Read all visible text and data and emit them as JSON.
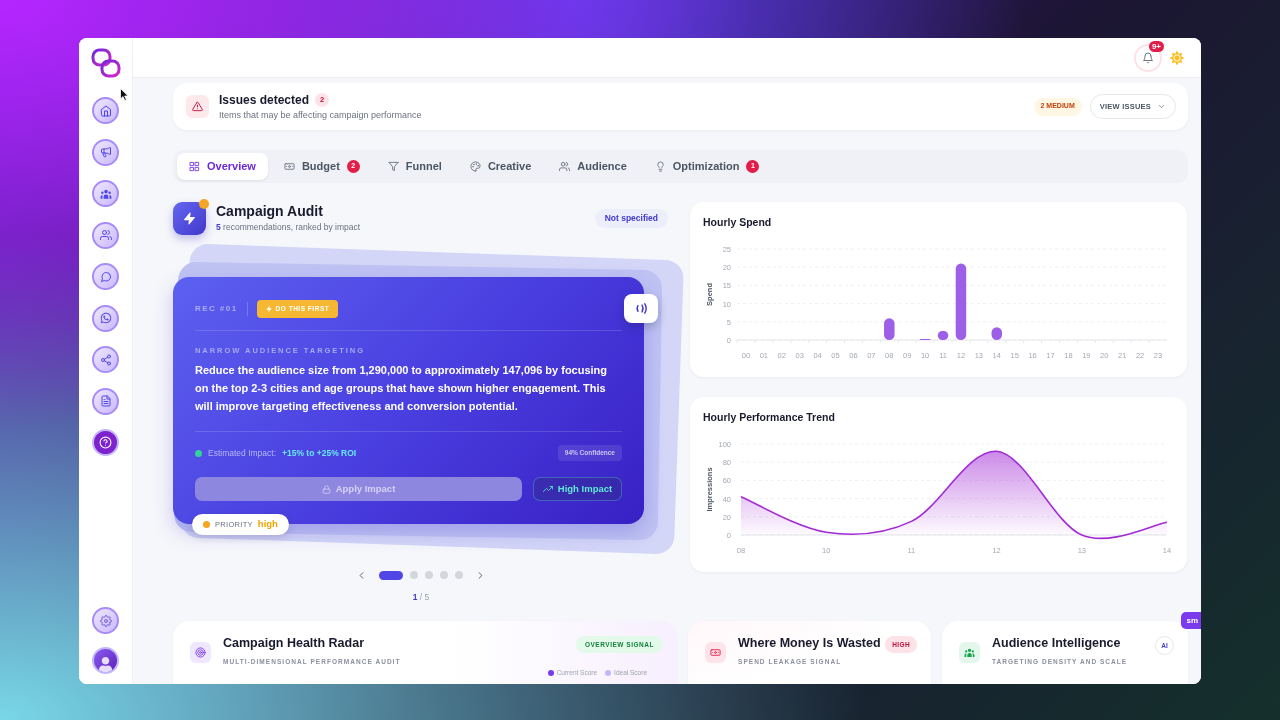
{
  "header": {
    "notification_badge": "9+"
  },
  "issues_banner": {
    "title": "Issues detected",
    "count": "2",
    "subtitle": "Items that may be affecting campaign performance",
    "severity": "2 MEDIUM",
    "action": "VIEW ISSUES"
  },
  "tabs": [
    {
      "label": "Overview",
      "selected": true
    },
    {
      "label": "Budget",
      "badge": "2",
      "selected": false
    },
    {
      "label": "Funnel",
      "selected": false
    },
    {
      "label": "Creative",
      "selected": false
    },
    {
      "label": "Audience",
      "selected": false
    },
    {
      "label": "Optimization",
      "badge": "1",
      "selected": false
    }
  ],
  "campaign_audit": {
    "title": "Campaign Audit",
    "subtitle": "**5** recommendations, ranked by impact",
    "status": "Not specified",
    "recommendation": {
      "rec_label": "REC #01",
      "tag": "DO THIS FIRST",
      "category": "NARROW AUDIENCE TARGETING",
      "description": "Reduce the audience size from 1,290,000 to approximately 147,096 by focusing on the top 2-3 cities and age groups that have shown higher engagement. This will improve targeting effectiveness and conversion potential.",
      "impact_label": "Estimated Impact:",
      "impact_value": "+15% to +25% ROI",
      "confidence": "94% Confidence",
      "apply_button": {
        "label": "Apply Impact",
        "disabled": true
      },
      "impact_button": "High Impact",
      "priority_label": "PRIORITY",
      "priority_value": "high"
    },
    "pagination": {
      "dots": [
        {
          "selected": true
        },
        {
          "selected": false
        },
        {
          "selected": false
        },
        {
          "selected": false
        },
        {
          "selected": false
        }
      ],
      "indicator": "**1** / 5"
    }
  },
  "hourly_spend": {
    "chart_data": {
      "type": "bar",
      "title": "Hourly Spend",
      "ylabel": "Spend",
      "categories": [
        "00",
        "01",
        "02",
        "03",
        "04",
        "05",
        "06",
        "07",
        "08",
        "09",
        "10",
        "11",
        "12",
        "13",
        "14",
        "15",
        "16",
        "17",
        "18",
        "19",
        "20",
        "21",
        "22",
        "23"
      ],
      "series": [
        {
          "color": "#9d5fe8",
          "values": [
            0,
            0,
            0,
            0,
            0,
            0,
            0,
            0,
            6,
            0,
            0.3,
            2.5,
            21,
            0,
            3.5,
            0,
            0,
            0,
            0,
            0,
            0,
            0,
            0,
            0
          ]
        }
      ],
      "ylim": [
        0,
        25
      ],
      "yticks": [
        0,
        5,
        10,
        15,
        20,
        25
      ],
      "grid": true
    }
  },
  "performance_trend": {
    "chart_data": {
      "type": "area",
      "title": "Hourly Performance Trend",
      "ylabel": "Impressions",
      "categories": [
        "08",
        "10",
        "11",
        "12",
        "13",
        "14"
      ],
      "series": [
        {
          "color": "#a22bd6",
          "values": [
            42,
            3,
            15,
            92,
            0,
            14
          ]
        }
      ],
      "ylim": [
        0,
        100
      ],
      "yticks": [
        0,
        20,
        40,
        60,
        80,
        100
      ],
      "grid": true
    }
  },
  "bottom_cards": [
    {
      "kind": "radar",
      "title": "Campaign Health Radar",
      "subtitle": "MULTI-DIMENSIONAL PERFORMANCE AUDIT",
      "badge": "OVERVIEW SIGNAL",
      "legend": [
        {
          "label": "Current Score",
          "color": "#7c3aed"
        },
        {
          "label": "Ideal Score",
          "color": "#c4b5fd"
        }
      ]
    },
    {
      "kind": "waste",
      "title": "Where Money Is Wasted",
      "subtitle": "SPEND LEAKAGE SIGNAL",
      "badge": "HIGH"
    },
    {
      "kind": "audience",
      "title": "Audience Intelligence",
      "subtitle": "TARGETING DENSITY AND SCALE",
      "badge": "AI"
    }
  ],
  "side_tab": "sm"
}
